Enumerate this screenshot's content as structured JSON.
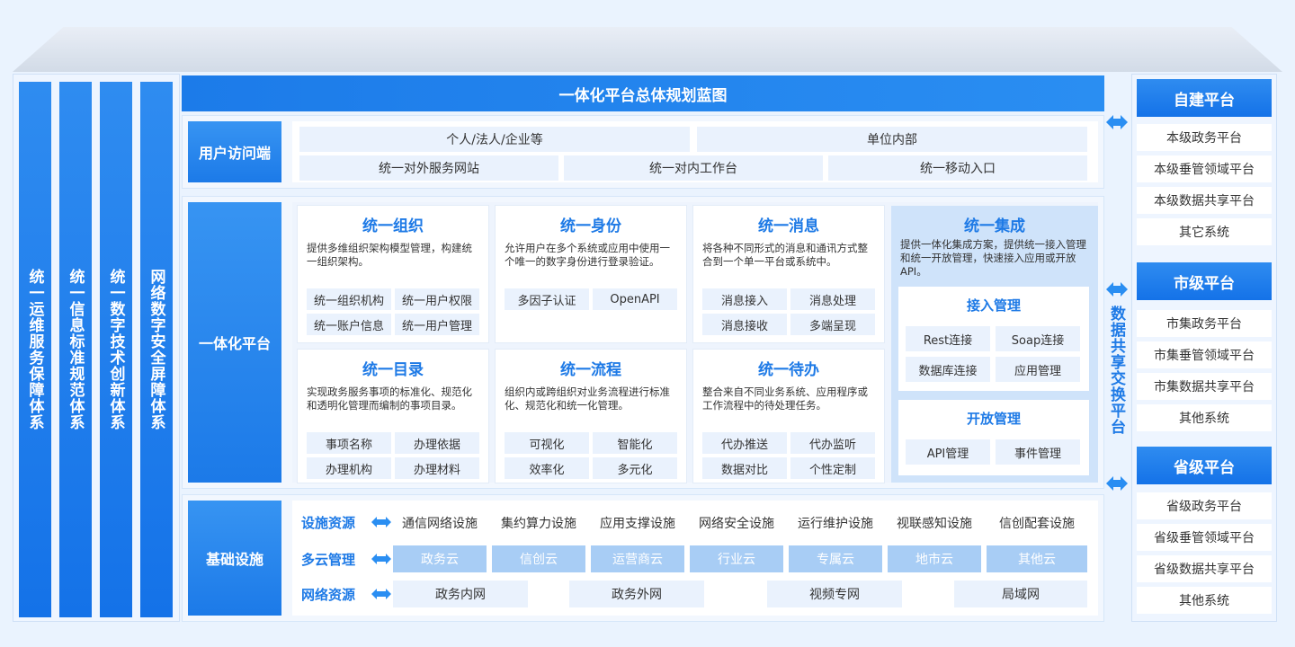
{
  "pillars": [
    "统一运维服务保障体系",
    "统一信息标准规范体系",
    "统一数字技术创新体系",
    "网络数字安全屏障体系"
  ],
  "title": "一体化平台总体规划蓝图",
  "user_access": {
    "label": "用户访问端",
    "row1": [
      "个人/法人/企业等",
      "单位内部"
    ],
    "row2": [
      "统一对外服务网站",
      "统一对内工作台",
      "统一移动入口"
    ]
  },
  "platform": {
    "label": "一体化平台",
    "cards": [
      {
        "title": "统一组织",
        "desc": "提供多维组织架构模型管理，构建统一组织架构。",
        "chips": [
          "统一组织机构",
          "统一用户权限",
          "统一账户信息",
          "统一用户管理"
        ]
      },
      {
        "title": "统一身份",
        "desc": "允许用户在多个系统或应用中使用一个唯一的数字身份进行登录验证。",
        "chips": [
          "多因子认证",
          "OpenAPI"
        ]
      },
      {
        "title": "统一消息",
        "desc": "将各种不同形式的消息和通讯方式整合到一个单一平台或系统中。",
        "chips": [
          "消息接入",
          "消息处理",
          "消息接收",
          "多端呈现"
        ]
      },
      {
        "title": "统一目录",
        "desc": "实现政务服务事项的标准化、规范化和透明化管理而编制的事项目录。",
        "chips": [
          "事项名称",
          "办理依据",
          "办理机构",
          "办理材料"
        ]
      },
      {
        "title": "统一流程",
        "desc": "组织内或跨组织对业务流程进行标准化、规范化和统一化管理。",
        "chips": [
          "可视化",
          "智能化",
          "效率化",
          "多元化"
        ]
      },
      {
        "title": "统一待办",
        "desc": "整合来自不同业务系统、应用程序或工作流程中的待处理任务。",
        "chips": [
          "代办推送",
          "代办监听",
          "数据对比",
          "个性定制"
        ]
      }
    ],
    "integration": {
      "title": "统一集成",
      "desc": "提供一体化集成方案，提供统一接入管理和统一开放管理，快速接入应用或开放API。",
      "access": {
        "title": "接入管理",
        "chips": [
          "Rest连接",
          "Soap连接",
          "数据库连接",
          "应用管理"
        ]
      },
      "open": {
        "title": "开放管理",
        "chips": [
          "API管理",
          "事件管理"
        ]
      }
    }
  },
  "infrastructure": {
    "label": "基础设施",
    "facility": {
      "label": "设施资源",
      "items": [
        "通信网络设施",
        "集约算力设施",
        "应用支撑设施",
        "网络安全设施",
        "运行维护设施",
        "视联感知设施",
        "信创配套设施"
      ]
    },
    "cloud": {
      "label": "多云管理",
      "items": [
        "政务云",
        "信创云",
        "运营商云",
        "行业云",
        "专属云",
        "地市云",
        "其他云"
      ]
    },
    "network": {
      "label": "网络资源",
      "items": [
        "政务内网",
        "政务外网",
        "视频专网",
        "局域网"
      ]
    }
  },
  "data_exchange_label": "数据共享交换平台",
  "right": [
    {
      "title": "自建平台",
      "items": [
        "本级政务平台",
        "本级垂管领域平台",
        "本级数据共享平台",
        "其它系统"
      ]
    },
    {
      "title": "市级平台",
      "items": [
        "市集政务平台",
        "市集垂管领域平台",
        "市集数据共享平台",
        "其他系统"
      ]
    },
    {
      "title": "省级平台",
      "items": [
        "省级政务平台",
        "省级垂管领域平台",
        "省级数据共享平台",
        "其他系统"
      ]
    }
  ],
  "colors": {
    "primary": "#1c7be9",
    "chip": "#eaf2fd",
    "cloud": "#a8cdf5"
  }
}
